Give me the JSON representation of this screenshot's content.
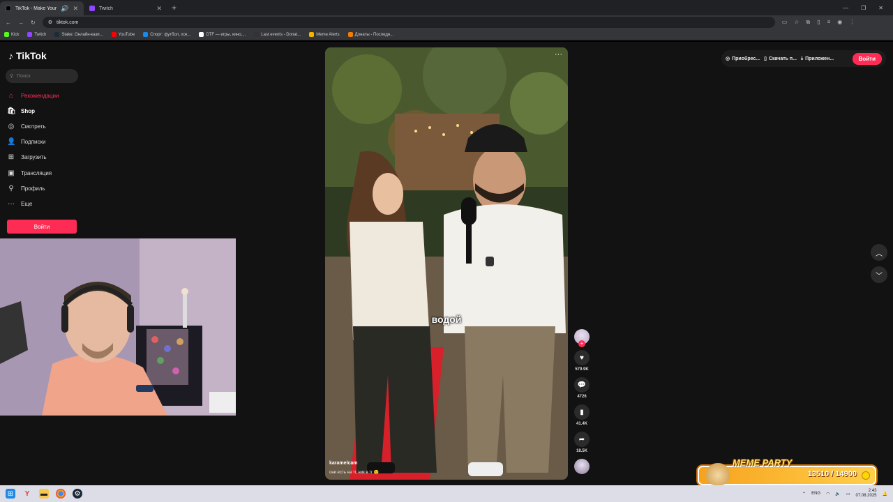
{
  "browser": {
    "tabs": [
      {
        "title": "TikTok - Make Your Day",
        "favicon_color": "#111111",
        "active": true
      },
      {
        "title": "Twitch",
        "favicon_color": "#9146ff",
        "active": false
      }
    ],
    "address": "tiktok.com",
    "bookmarks": [
      {
        "label": "Kick",
        "color": "#53fc18"
      },
      {
        "label": "Twitch",
        "color": "#9146ff"
      },
      {
        "label": "Stake: Онлайн-кази...",
        "color": "#1a2c38"
      },
      {
        "label": "YouTube",
        "color": "#ff0000"
      },
      {
        "label": "Спорт: футбол, хок...",
        "color": "#1e88e5"
      },
      {
        "label": "DTF — игры, кино,...",
        "color": "#ffffff"
      },
      {
        "label": "Last events - Donat...",
        "color": "#333333"
      },
      {
        "label": "Meme Alerts",
        "color": "#f5b400"
      },
      {
        "label": "Донаты - Последн...",
        "color": "#f57c00"
      }
    ]
  },
  "sidebar": {
    "logo": "TikTok",
    "search_placeholder": "Поиск",
    "items": [
      {
        "label": "Рекомендации",
        "icon": "home-icon",
        "glyph": "⌂"
      },
      {
        "label": "Shop",
        "icon": "shop-icon",
        "glyph": "🛍"
      },
      {
        "label": "Смотреть",
        "icon": "compass-icon",
        "glyph": "◎"
      },
      {
        "label": "Подписки",
        "icon": "following-icon",
        "glyph": "👤"
      },
      {
        "label": "Загрузить",
        "icon": "upload-icon",
        "glyph": "⊞"
      },
      {
        "label": "Трансляция",
        "icon": "live-icon",
        "glyph": "▣"
      },
      {
        "label": "Профиль",
        "icon": "profile-icon",
        "glyph": "⚲"
      },
      {
        "label": "Еще",
        "icon": "more-icon",
        "glyph": "···"
      }
    ],
    "login": "Войти"
  },
  "video": {
    "caption": "водой",
    "author": "karamelcam",
    "description": "они есть на тг, ник в тг 😉"
  },
  "actions": {
    "likes": "579.9K",
    "comments": "4726",
    "saves": "41.4K",
    "shares": "18.5K"
  },
  "topbar": {
    "buy": "Приобрес...",
    "download": "Скачать п...",
    "app": "Приложен...",
    "login": "Войти"
  },
  "overlay": {
    "title": "MEME PARTY",
    "score": "13510 / 14900"
  },
  "taskbar": {
    "lang": "ENG",
    "time": "2:43",
    "date": "07.08.2025"
  },
  "colors": {
    "accent": "#fe2c55",
    "background": "#121212"
  }
}
